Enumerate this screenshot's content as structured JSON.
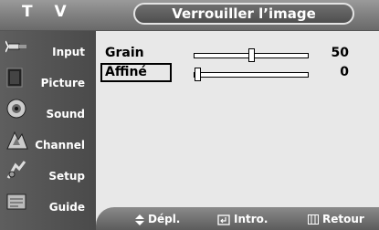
{
  "header": {
    "mode": "T V",
    "title": "Verrouiller l’image"
  },
  "sidebar": {
    "items": [
      {
        "label": "Input",
        "icon": "input-icon"
      },
      {
        "label": "Picture",
        "icon": "picture-icon"
      },
      {
        "label": "Sound",
        "icon": "sound-icon"
      },
      {
        "label": "Channel",
        "icon": "channel-icon"
      },
      {
        "label": "Setup",
        "icon": "setup-icon"
      },
      {
        "label": "Guide",
        "icon": "guide-icon"
      }
    ]
  },
  "settings": [
    {
      "label": "Grain",
      "value": "50",
      "level": 0.5,
      "selected": false
    },
    {
      "label": "Affiné",
      "value": "0",
      "level": 0.0,
      "selected": true
    }
  ],
  "footer": {
    "move": "Dépl.",
    "enter": "Intro.",
    "return": "Retour"
  },
  "colors": {
    "menu_bg": "#e8e8e8",
    "sidebar": "#555555",
    "text": "#000000"
  }
}
